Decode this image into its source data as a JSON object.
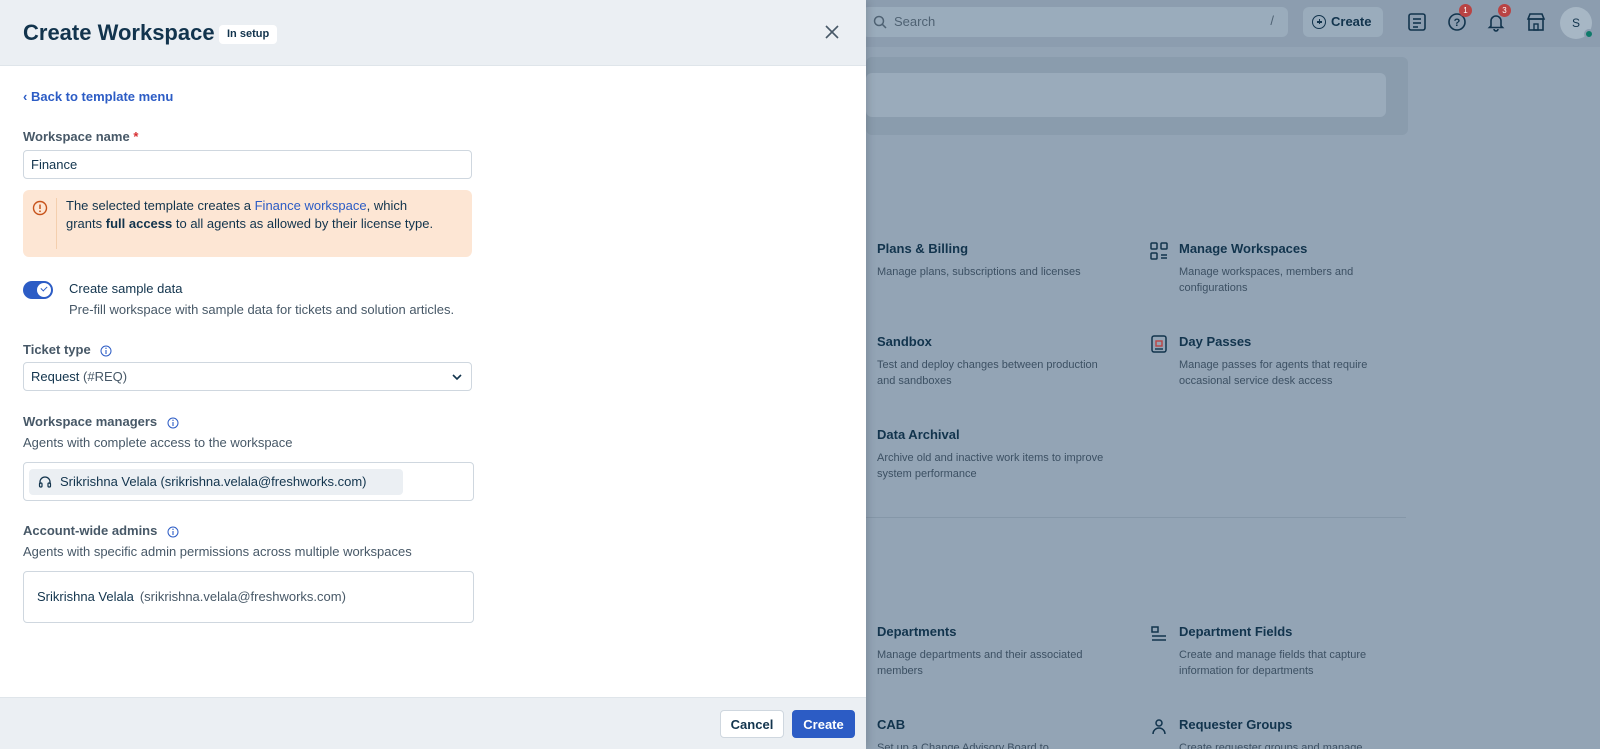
{
  "topbar": {
    "search_placeholder": "Search",
    "search_shortcut": "/",
    "create_label": "Create",
    "help_badge": "1",
    "notif_badge": "3",
    "avatar_initial": "S"
  },
  "tiles": [
    {
      "title": "Plans & Billing",
      "desc": "Manage plans, subscriptions and licenses",
      "icon": "billing-icon"
    },
    {
      "title": "Manage Workspaces",
      "desc": "Manage workspaces, members and configurations",
      "icon": "workspaces-icon"
    },
    {
      "title": "Sandbox",
      "desc": "Test and deploy changes between production and sandboxes",
      "icon": "sandbox-icon"
    },
    {
      "title": "Day Passes",
      "desc": "Manage passes for agents that require occasional service desk access",
      "icon": "day-pass-icon"
    },
    {
      "title": "Data Archival",
      "desc": "Archive old and inactive work items to improve system performance",
      "icon": "archive-icon"
    },
    {
      "title": "Departments",
      "desc": "Manage departments and their associated members",
      "icon": "departments-icon"
    },
    {
      "title": "Department Fields",
      "desc": "Create and manage fields that capture information for departments",
      "icon": "department-fields-icon"
    },
    {
      "title": "CAB",
      "desc": "Set up a Change Advisory Board to",
      "icon": "cab-icon"
    },
    {
      "title": "Requester Groups",
      "desc": "Create requester groups and manage",
      "icon": "requester-groups-icon"
    }
  ],
  "modal": {
    "title": "Create Workspace",
    "status": "In setup",
    "back_link": "Back to template menu",
    "workspace_name_label": "Workspace name",
    "required_mark": "*",
    "workspace_name_value": "Finance",
    "notice": {
      "part1": "The selected template creates a ",
      "link": "Finance workspace",
      "part2": ", which grants ",
      "bold": "full access",
      "part3": " to all agents as allowed by their license type."
    },
    "sample_data": {
      "enabled": true,
      "title": "Create sample data",
      "desc": "Pre-fill workspace with sample data for tickets and solution articles."
    },
    "ticket_type": {
      "label": "Ticket type",
      "value_main": "Request",
      "value_code": " (#REQ)"
    },
    "managers": {
      "label": "Workspace managers",
      "desc": "Agents with complete access to the workspace",
      "chip": "Srikrishna Velala (srikrishna.velala@freshworks.com)"
    },
    "admins": {
      "label": "Account-wide admins",
      "desc": "Agents with specific admin permissions across multiple workspaces",
      "name": "Srikrishna Velala",
      "email": "(srikrishna.velala@freshworks.com)"
    },
    "footer": {
      "cancel_label": "Cancel",
      "create_label": "Create"
    }
  },
  "colors": {
    "accent": "#2c5cc5",
    "notice_bg": "#fde6d4",
    "warning_icon": "#c7531b",
    "badge": "#b94343"
  }
}
